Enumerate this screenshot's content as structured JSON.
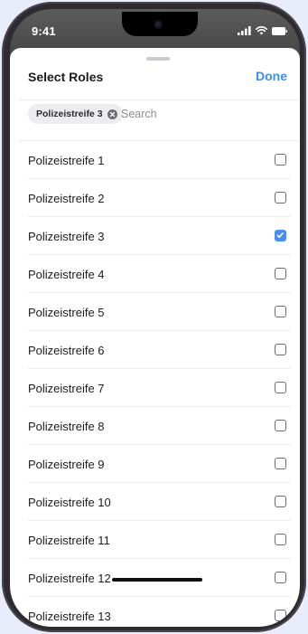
{
  "status_bar": {
    "time": "9:41"
  },
  "sheet": {
    "title": "Select Roles",
    "done_label": "Done",
    "selected_chip": "Polizeistreife 3",
    "search_placeholder": "Search",
    "items": [
      {
        "label": "Polizeistreife 1",
        "checked": false
      },
      {
        "label": "Polizeistreife 2",
        "checked": false
      },
      {
        "label": "Polizeistreife 3",
        "checked": true
      },
      {
        "label": "Polizeistreife 4",
        "checked": false
      },
      {
        "label": "Polizeistreife 5",
        "checked": false
      },
      {
        "label": "Polizeistreife 6",
        "checked": false
      },
      {
        "label": "Polizeistreife 7",
        "checked": false
      },
      {
        "label": "Polizeistreife 8",
        "checked": false
      },
      {
        "label": "Polizeistreife 9",
        "checked": false
      },
      {
        "label": "Polizeistreife 10",
        "checked": false
      },
      {
        "label": "Polizeistreife 11",
        "checked": false
      },
      {
        "label": "Polizeistreife 12",
        "checked": false
      },
      {
        "label": "Polizeistreife 13",
        "checked": false
      }
    ]
  },
  "colors": {
    "accent": "#3d8ee8",
    "checkbox_checked": "#4b8fe8"
  },
  "icons": {
    "chip_remove": "close-circle-icon",
    "checkbox_checked": "checkmark-icon"
  }
}
